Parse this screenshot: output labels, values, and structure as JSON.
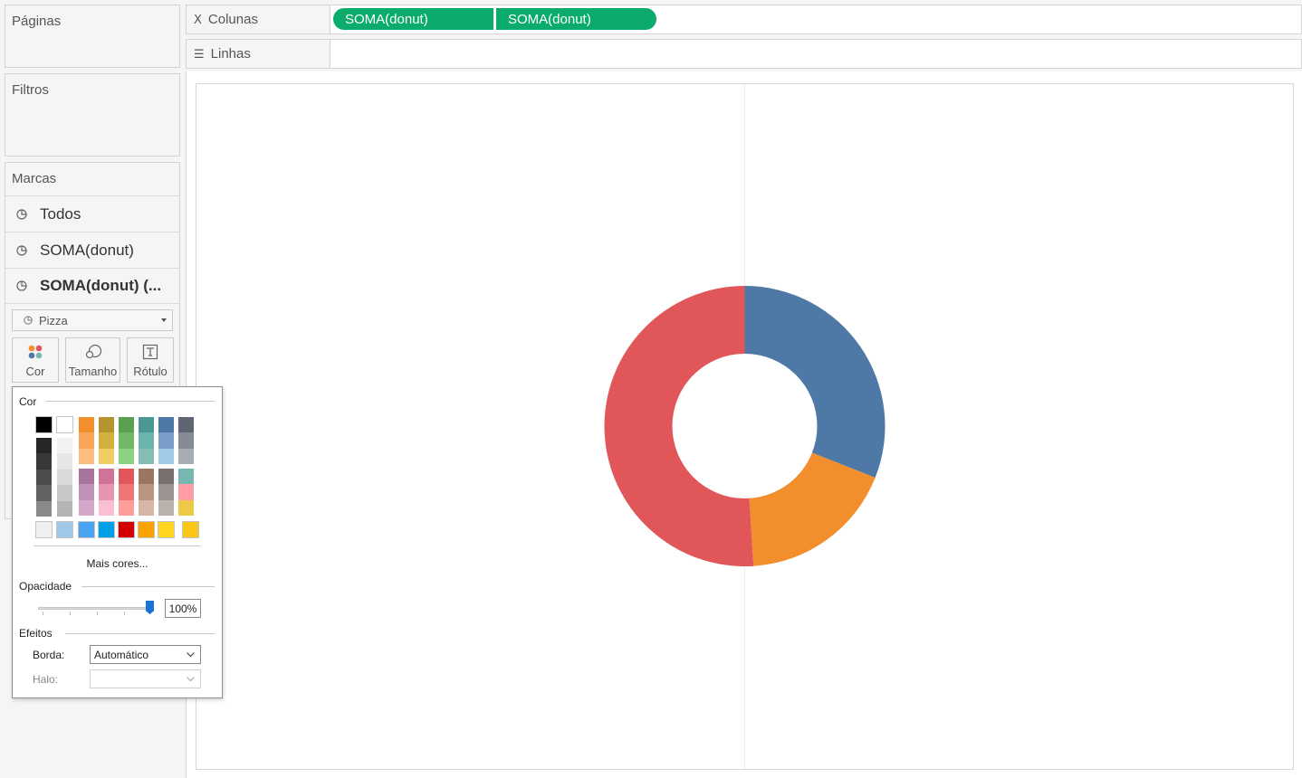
{
  "left_panel": {
    "pages_title": "Páginas",
    "filters_title": "Filtros",
    "marks": {
      "title": "Marcas",
      "rows": [
        {
          "label": "Todos",
          "bold": false
        },
        {
          "label": "SOMA(donut)",
          "bold": false
        },
        {
          "label": "SOMA(donut) (...",
          "bold": true
        }
      ],
      "mark_type": "Pizza",
      "buttons": {
        "color": "Cor",
        "size": "Tamanho",
        "label": "Rótulo"
      }
    }
  },
  "shelves": {
    "columns_label": "Colunas",
    "rows_label": "Linhas",
    "column_pills": [
      "SOMA(donut)",
      "SOMA(donut)"
    ],
    "pill_color": "#0bab6c"
  },
  "color_popup": {
    "title": "Cor",
    "more_colors": "Mais cores...",
    "opacity_title": "Opacidade",
    "opacity_value": "100%",
    "effects_title": "Efeitos",
    "border_label": "Borda:",
    "border_value": "Automático",
    "halo_label": "Halo:",
    "halo_value": "",
    "bw_light": [
      "#ffffff",
      "#f2f2f2",
      "#e6e6e6",
      "#d9d9d9",
      "#c8c8c8",
      "#b4b4b4"
    ],
    "bw_dark": [
      "#000000",
      "#262626",
      "#383838",
      "#4d4d4d",
      "#636363",
      "#8a8a8a"
    ],
    "palette_top": [
      [
        "#f28e2b",
        "#f9a65a",
        "#ffbe7d"
      ],
      [
        "#b3942e",
        "#d4b13f",
        "#f1ce63"
      ],
      [
        "#59a14f",
        "#6fb964",
        "#8cd17d"
      ],
      [
        "#499894",
        "#6cb3ad",
        "#86bcb6"
      ],
      [
        "#4e79a7",
        "#7a9ec9",
        "#a0cbe8"
      ],
      [
        "#5f6573",
        "#858a96",
        "#a8acb3"
      ]
    ],
    "palette_bottom": [
      [
        "#a8739c",
        "#c192b9",
        "#d4a6c8"
      ],
      [
        "#d0729a",
        "#e893b1",
        "#fabfd2"
      ],
      [
        "#e15759",
        "#f07575",
        "#ff9d9a"
      ],
      [
        "#9d7660",
        "#bb957f",
        "#d7b5a6"
      ],
      [
        "#79706e",
        "#9b9392",
        "#bab0ac"
      ],
      [
        "#76b7b2",
        "#ff9da7",
        "#edc948"
      ]
    ],
    "standard": [
      "#f0f0f0",
      "#9fc8e8",
      "#4aa3f0",
      "#009fe8",
      "#d20000",
      "#f9a200",
      "#ffd520",
      "#f9c619"
    ]
  },
  "chart_data": {
    "type": "pie",
    "title": "",
    "donut": true,
    "values": [
      0.31,
      0.18,
      0.51
    ],
    "colors": [
      "#4e79a7",
      "#f28e2b",
      "#e15759"
    ]
  }
}
